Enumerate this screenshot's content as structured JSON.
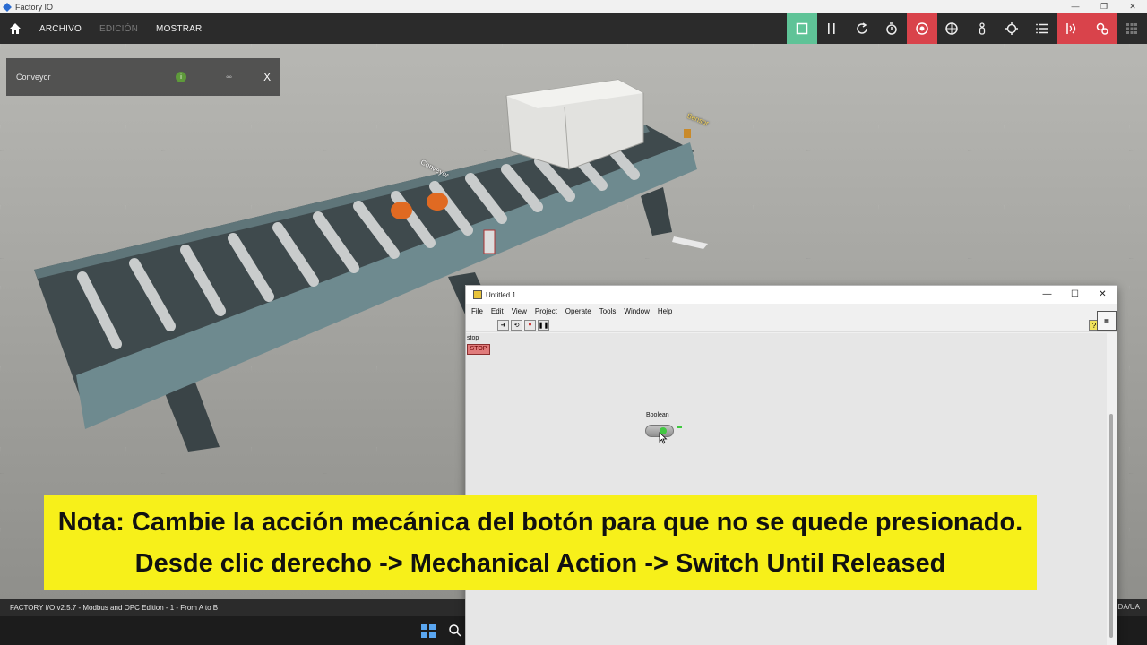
{
  "window": {
    "title": "Factory IO",
    "controls": [
      "—",
      "❐",
      "✕"
    ]
  },
  "menubar": {
    "items": [
      {
        "label": "ARCHIVO",
        "enabled": true
      },
      {
        "label": "EDICIÓN",
        "enabled": false
      },
      {
        "label": "MOSTRAR",
        "enabled": true
      }
    ],
    "tools": [
      {
        "icon": "stop-square-icon",
        "state": "active-green"
      },
      {
        "icon": "pause-icon",
        "state": "normal"
      },
      {
        "icon": "reset-icon",
        "state": "normal"
      },
      {
        "icon": "timer-icon",
        "state": "normal"
      },
      {
        "icon": "camera-orbit-icon",
        "state": "active-red"
      },
      {
        "icon": "camera-fly-icon",
        "state": "normal"
      },
      {
        "icon": "camera-first-person-icon",
        "state": "normal"
      },
      {
        "icon": "crosshair-icon",
        "state": "normal"
      },
      {
        "icon": "list-icon",
        "state": "normal"
      },
      {
        "icon": "sensor-signal-icon",
        "state": "active-red"
      },
      {
        "icon": "drivers-icon",
        "state": "active-red"
      },
      {
        "icon": "grid-icon",
        "state": "disabled"
      }
    ],
    "active_green_color": "#5fc397",
    "active_red_color": "#d9434b"
  },
  "properties_panel": {
    "name": "Conveyor",
    "status_icon": "i",
    "close_label": "X"
  },
  "scene_labels": {
    "conveyor": "Conveyor",
    "sensor": "Sensor"
  },
  "statusbar": {
    "text": "FACTORY I/O v2.5.7 - Modbus and OPC Edition - 1 - From A to B",
    "right_text": "DA/UA"
  },
  "labview": {
    "title": "Untitled 1",
    "menu": [
      "File",
      "Edit",
      "View",
      "Project",
      "Operate",
      "Tools",
      "Window",
      "Help"
    ],
    "help_label": "?",
    "stop_label": "stop",
    "stop_button": "STOP",
    "boolean_label": "Boolean"
  },
  "subtitle": {
    "line1": "Nota: Cambie la acción mecánica del botón para que no se quede presionado.",
    "line2": "Desde clic derecho -> Mechanical Action -> Switch Until Released"
  }
}
